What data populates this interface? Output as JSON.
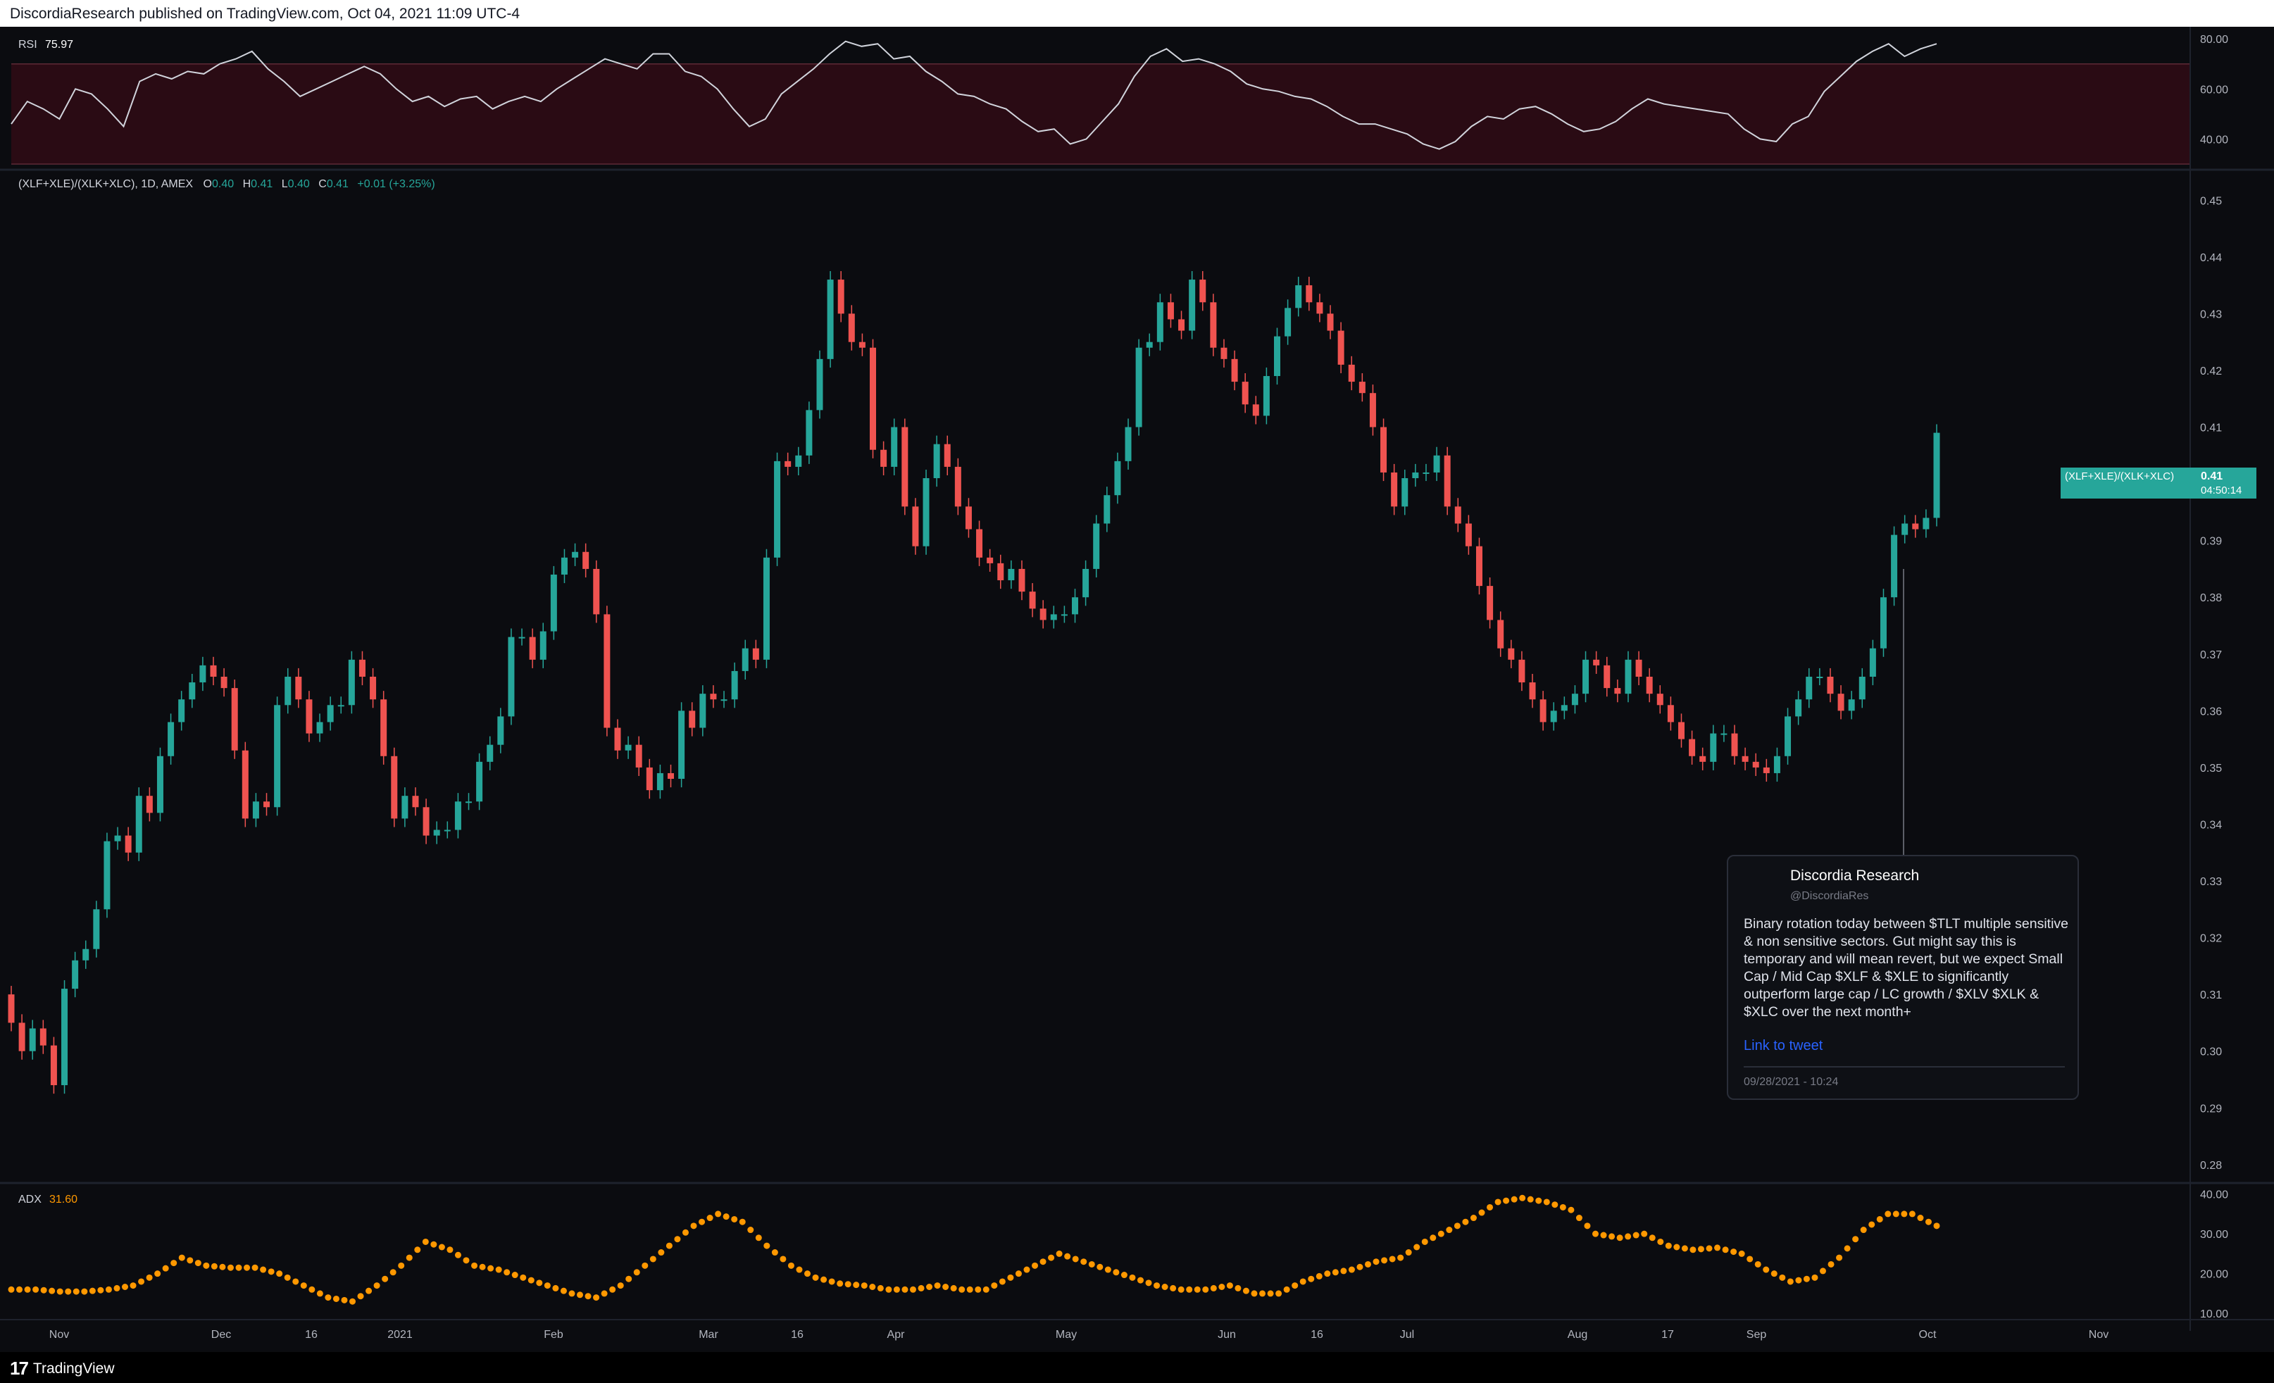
{
  "header": {
    "published": "DiscordiaResearch published on TradingView.com, Oct 04, 2021 11:09 UTC-4"
  },
  "footer": {
    "brand": "TradingView"
  },
  "rsi": {
    "label": "RSI",
    "value": "75.97"
  },
  "main_legend": {
    "symbol": "(XLF+XLE)/(XLK+XLC), 1D, AMEX",
    "o_label": "O",
    "o": "0.40",
    "h_label": "H",
    "h": "0.41",
    "l_label": "L",
    "l": "0.40",
    "c_label": "C",
    "c": "0.41",
    "change": "+0.01 (+3.25%)"
  },
  "adx": {
    "label": "ADX",
    "value": "31.60"
  },
  "price_tag": {
    "symbol": "(XLF+XLE)/(XLK+XLC)",
    "value": "0.41",
    "countdown": "04:50:14"
  },
  "tweet": {
    "author": "Discordia Research",
    "handle": "@DiscordiaRes",
    "body": "Binary rotation today between $TLT multiple sensitive & non sensitive sectors. Gut might say this is temporary and will mean revert, but we expect Small Cap / Mid Cap $XLF & $XLE to significantly outperform large cap / LC growth / $XLV $XLK & $XLC over the next month+",
    "link": "Link to tweet",
    "date": "09/28/2021 - 10:24"
  },
  "colors": {
    "up": "#26a69a",
    "down": "#ef5350",
    "rsi_line": "#d1d4dc",
    "rsi_band": "#2a0b14",
    "adx": "#ff9800",
    "bg": "#0b0c10"
  },
  "chart_data": [
    {
      "type": "line",
      "name": "RSI",
      "y_ticks": [
        "80.00",
        "60.00",
        "40.00"
      ],
      "ylim": [
        30,
        82
      ],
      "band": [
        30,
        70
      ],
      "values": [
        46,
        55,
        52,
        48,
        60,
        58,
        52,
        45,
        63,
        66,
        64,
        67,
        66,
        70,
        72,
        75,
        68,
        63,
        57,
        60,
        63,
        66,
        69,
        66,
        60,
        55,
        57,
        53,
        56,
        57,
        52,
        55,
        57,
        55,
        60,
        64,
        68,
        72,
        70,
        68,
        74,
        74,
        67,
        65,
        60,
        52,
        45,
        48,
        58,
        63,
        68,
        74,
        79,
        77,
        78,
        72,
        73,
        67,
        63,
        58,
        57,
        54,
        52,
        47,
        43,
        44,
        38,
        40,
        47,
        54,
        65,
        73,
        76,
        71,
        72,
        70,
        67,
        62,
        60,
        59,
        57,
        56,
        53,
        49,
        46,
        46,
        44,
        42,
        38,
        36,
        39,
        45,
        49,
        48,
        52,
        53,
        50,
        46,
        43,
        44,
        47,
        52,
        56,
        54,
        53,
        52,
        51,
        50,
        44,
        40,
        39,
        46,
        49,
        59,
        65,
        71,
        75,
        78,
        73,
        76,
        78
      ]
    },
    {
      "type": "candlestick",
      "name": "(XLF+XLE)/(XLK+XLC)",
      "y_ticks": [
        "0.45",
        "0.44",
        "0.43",
        "0.42",
        "0.41",
        "0.40",
        "0.39",
        "0.38",
        "0.37",
        "0.36",
        "0.35",
        "0.34",
        "0.33",
        "0.32",
        "0.31",
        "0.30",
        "0.29",
        "0.28"
      ],
      "ylim": [
        0.277,
        0.455
      ],
      "x_labels": [
        "Nov",
        "Dec",
        "16",
        "2021",
        "Feb",
        "Mar",
        "16",
        "Apr",
        "May",
        "Jun",
        "16",
        "Jul",
        "Aug",
        "17",
        "Sep",
        "Oct",
        "Nov"
      ],
      "closes": [
        0.305,
        0.3,
        0.304,
        0.301,
        0.294,
        0.311,
        0.316,
        0.318,
        0.325,
        0.337,
        0.338,
        0.335,
        0.345,
        0.342,
        0.352,
        0.358,
        0.362,
        0.365,
        0.368,
        0.366,
        0.364,
        0.353,
        0.341,
        0.344,
        0.343,
        0.361,
        0.366,
        0.362,
        0.356,
        0.358,
        0.361,
        0.361,
        0.369,
        0.366,
        0.362,
        0.352,
        0.341,
        0.345,
        0.343,
        0.338,
        0.339,
        0.339,
        0.344,
        0.344,
        0.351,
        0.354,
        0.359,
        0.373,
        0.373,
        0.369,
        0.374,
        0.384,
        0.387,
        0.388,
        0.385,
        0.377,
        0.357,
        0.353,
        0.354,
        0.35,
        0.346,
        0.349,
        0.348,
        0.36,
        0.357,
        0.363,
        0.362,
        0.362,
        0.367,
        0.371,
        0.369,
        0.387,
        0.404,
        0.403,
        0.405,
        0.413,
        0.422,
        0.436,
        0.43,
        0.425,
        0.424,
        0.406,
        0.403,
        0.41,
        0.396,
        0.389,
        0.401,
        0.407,
        0.403,
        0.396,
        0.392,
        0.387,
        0.386,
        0.383,
        0.385,
        0.381,
        0.378,
        0.376,
        0.377,
        0.377,
        0.38,
        0.385,
        0.393,
        0.398,
        0.404,
        0.41,
        0.424,
        0.425,
        0.432,
        0.429,
        0.427,
        0.436,
        0.432,
        0.424,
        0.422,
        0.418,
        0.414,
        0.412,
        0.419,
        0.426,
        0.431,
        0.435,
        0.432,
        0.43,
        0.427,
        0.421,
        0.418,
        0.416,
        0.41,
        0.402,
        0.396,
        0.401,
        0.402,
        0.402,
        0.405,
        0.396,
        0.393,
        0.389,
        0.382,
        0.376,
        0.371,
        0.369,
        0.365,
        0.362,
        0.358,
        0.36,
        0.361,
        0.363,
        0.369,
        0.368,
        0.364,
        0.363,
        0.369,
        0.366,
        0.363,
        0.361,
        0.358,
        0.355,
        0.352,
        0.351,
        0.356,
        0.356,
        0.352,
        0.351,
        0.35,
        0.349,
        0.352,
        0.359,
        0.362,
        0.366,
        0.366,
        0.363,
        0.36,
        0.362,
        0.366,
        0.371,
        0.38,
        0.391,
        0.393,
        0.392,
        0.394,
        0.409
      ]
    },
    {
      "type": "scatter",
      "name": "ADX",
      "y_ticks": [
        "40.00",
        "30.00",
        "20.00",
        "10.00"
      ],
      "ylim": [
        9.5,
        41
      ],
      "x": [
        0,
        35,
        70,
        105,
        140,
        175,
        210,
        245,
        280,
        315,
        350,
        385,
        420,
        455,
        490,
        525,
        560,
        595,
        630,
        665,
        700,
        735,
        770,
        805,
        840,
        875,
        910,
        945,
        980,
        1015,
        1050,
        1085,
        1120,
        1155,
        1190,
        1225,
        1260,
        1295,
        1330,
        1365,
        1400,
        1435,
        1470,
        1505,
        1540,
        1575,
        1610,
        1645,
        1680,
        1715,
        1750,
        1785,
        1820,
        1855,
        1890,
        1925,
        1960,
        1995,
        2030,
        2065,
        2100,
        2135,
        2170,
        2205,
        2240,
        2275,
        2310,
        2345,
        2380,
        2415,
        2450,
        2485,
        2520,
        2555,
        2590,
        2625,
        2660,
        2695,
        2730,
        2765
      ],
      "values": [
        16,
        16,
        15.5,
        15.5,
        16,
        17,
        20,
        24,
        22,
        21.5,
        21.5,
        20,
        17,
        14,
        13,
        17,
        22,
        28,
        26,
        22,
        21,
        19,
        17,
        15,
        14,
        17,
        22,
        27,
        32,
        35,
        33,
        27,
        22,
        19,
        17.5,
        17,
        16,
        16,
        17,
        16,
        16,
        19,
        22,
        25,
        23,
        21,
        19,
        17,
        16,
        16,
        17,
        15,
        15,
        18,
        20,
        21,
        23,
        24,
        28,
        31,
        34,
        38,
        39,
        38,
        36,
        30,
        29,
        30,
        27,
        26,
        26.5,
        25,
        21,
        18,
        19,
        24,
        31,
        35,
        35,
        32
      ]
    }
  ]
}
